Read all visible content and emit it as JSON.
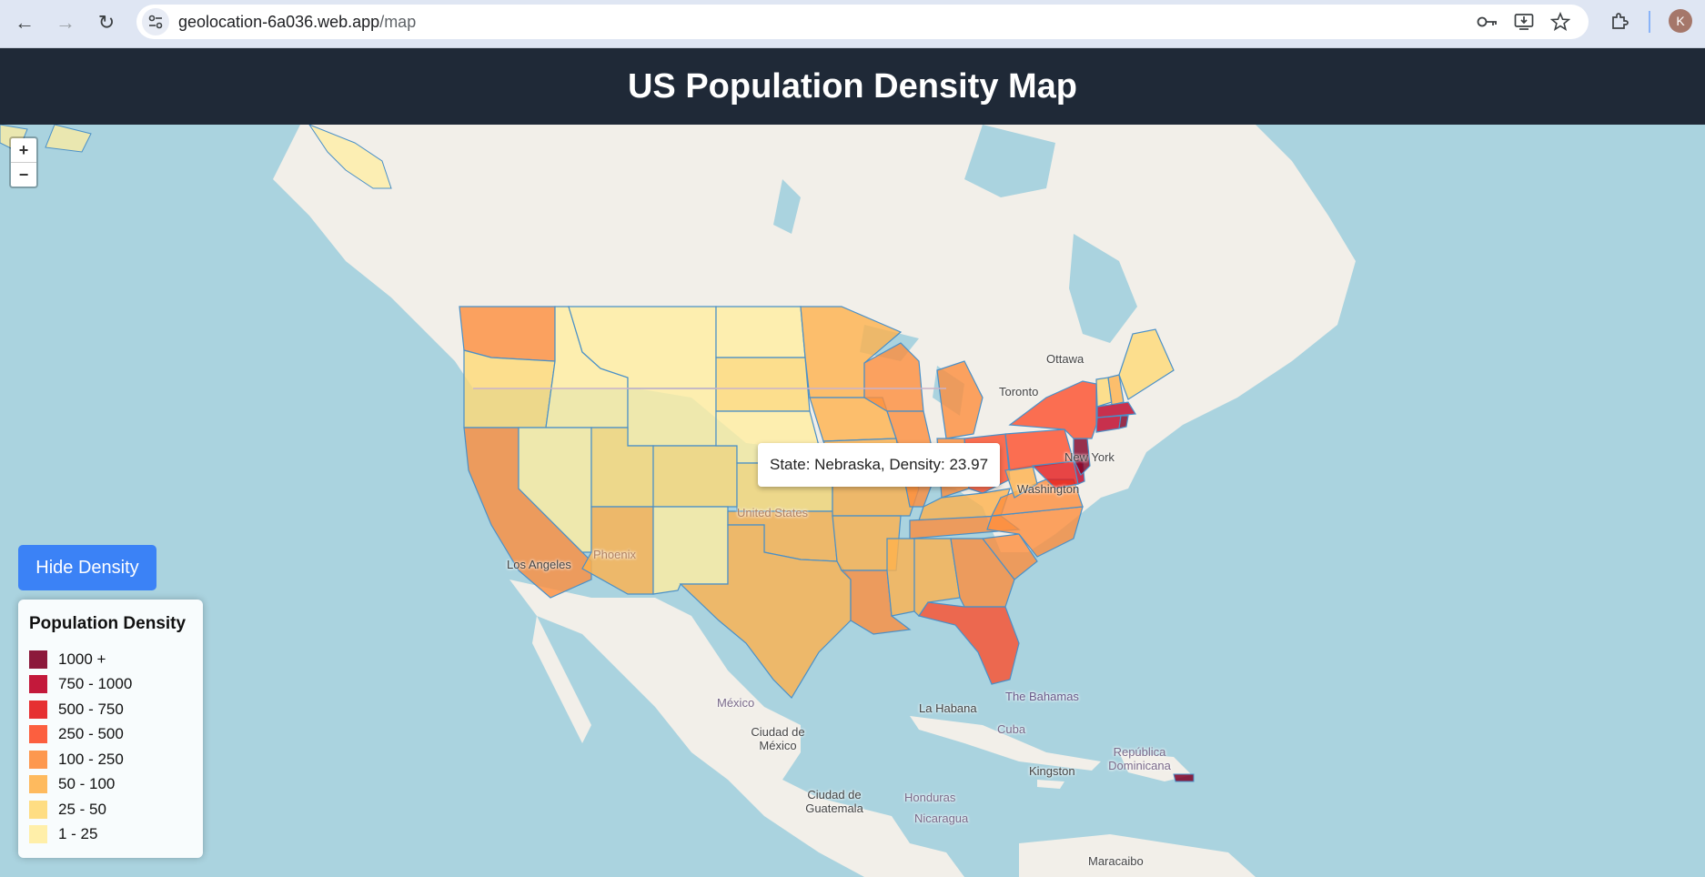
{
  "browser": {
    "url_host": "geolocation-6a036.web.app",
    "url_path": "/map",
    "avatar_letter": "K"
  },
  "header": {
    "title": "US Population Density Map"
  },
  "map": {
    "zoom_in_label": "+",
    "zoom_out_label": "−",
    "toggle_label": "Hide Density",
    "tooltip": "State: Nebraska, Density: 23.97",
    "labels": {
      "ottawa": "Ottawa",
      "toronto": "Toronto",
      "new_york": "New York",
      "washington": "Washington",
      "united_states": "United States",
      "phoenix": "Phoenix",
      "los_angeles": "Los Angeles",
      "mexico": "México",
      "ciudad_de_mexico": "Ciudad de México",
      "la_habana": "La Habana",
      "cuba": "Cuba",
      "the_bahamas": "The Bahamas",
      "republica_dominicana": "República Dominicana",
      "kingston": "Kingston",
      "honduras": "Honduras",
      "nicaragua": "Nicaragua",
      "ciudad_de_guatemala": "Ciudad de Guatemala",
      "maracaibo": "Maracaibo"
    }
  },
  "legend": {
    "title": "Population Density",
    "items": [
      {
        "label": "1000 +",
        "color": "#800026"
      },
      {
        "label": "750 - 1000",
        "color": "#BD0026"
      },
      {
        "label": "500 - 750",
        "color": "#E31A1C"
      },
      {
        "label": "250 - 500",
        "color": "#FC4E2A"
      },
      {
        "label": "100 - 250",
        "color": "#FD8D3C"
      },
      {
        "label": "50 - 100",
        "color": "#FEB24C"
      },
      {
        "label": "25 - 50",
        "color": "#FED976"
      },
      {
        "label": "1 - 25",
        "color": "#FFEDA0"
      }
    ]
  },
  "colors": {
    "header_bg": "#1f2937",
    "button_bg": "#3b82f6",
    "land": "#f2efe9",
    "water": "#aad3df",
    "state_border": "#4a90c8"
  }
}
